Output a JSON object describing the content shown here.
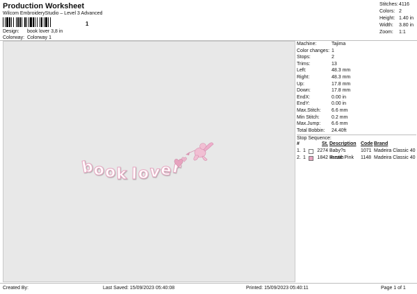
{
  "header": {
    "title": "Production Worksheet",
    "subtitle": "Wilcom EmbroideryStudio – Level 3 Advanced",
    "barcode_mark": "1",
    "design_label": "Design:",
    "design_value": "book lover 3,8 in",
    "colorway_label": "Colorway:",
    "colorway_value": "Colorway 1"
  },
  "stats": [
    {
      "label": "Stitches:",
      "value": "4116"
    },
    {
      "label": "Colors:",
      "value": "2"
    },
    {
      "label": "Height:",
      "value": "1.40 in"
    },
    {
      "label": "Width:",
      "value": "3.80 in"
    },
    {
      "label": "Zoom:",
      "value": "1:1"
    }
  ],
  "details": [
    {
      "label": "Machine:",
      "value": "Tajima"
    },
    {
      "label": "Color changes:",
      "value": "1"
    },
    {
      "label": "Stops:",
      "value": "2"
    },
    {
      "label": "Trims:",
      "value": "13"
    },
    {
      "label": "Left:",
      "value": "48.3 mm"
    },
    {
      "label": "Right:",
      "value": "48.3 mm"
    },
    {
      "label": "Up:",
      "value": "17.8 mm"
    },
    {
      "label": "Down:",
      "value": "17.8 mm"
    },
    {
      "label": "EndX:",
      "value": "0.00 in"
    },
    {
      "label": "EndY:",
      "value": "0.00 in"
    },
    {
      "label": "Max.Stitch:",
      "value": "6.6 mm"
    },
    {
      "label": "Min Stitch:",
      "value": "0.2 mm"
    },
    {
      "label": "Max.Jump:",
      "value": "6.6 mm"
    },
    {
      "label": "Total Bobbin:",
      "value": "24.40ft"
    }
  ],
  "sequence": {
    "title": "Stop Sequence:",
    "headers": {
      "idx": "#",
      "stop": "",
      "st": "St.",
      "desc": "Description",
      "code": "Code",
      "brand": "Brand"
    },
    "rows": [
      {
        "idx": "1.",
        "stop": "1",
        "swatch": "#ffffff",
        "st": "2274",
        "desc": "Baby?s Breath",
        "code": "1071",
        "brand": "Madeira Classic 40"
      },
      {
        "idx": "2.",
        "stop": "1",
        "swatch": "#e7a3bf",
        "st": "1842",
        "desc": "Rustic Pink",
        "code": "1148",
        "brand": "Madeira Classic 40"
      }
    ]
  },
  "design": {
    "text": "booklover",
    "thread_white": "#ffffff",
    "thread_pink": "#e7a3bf"
  },
  "footer": {
    "created": "Created By:",
    "saved": "Last Saved: 15/09/2023 05:40:08",
    "printed": "Printed: 15/09/2023 05:40:11",
    "page": "Page 1 of 1"
  }
}
